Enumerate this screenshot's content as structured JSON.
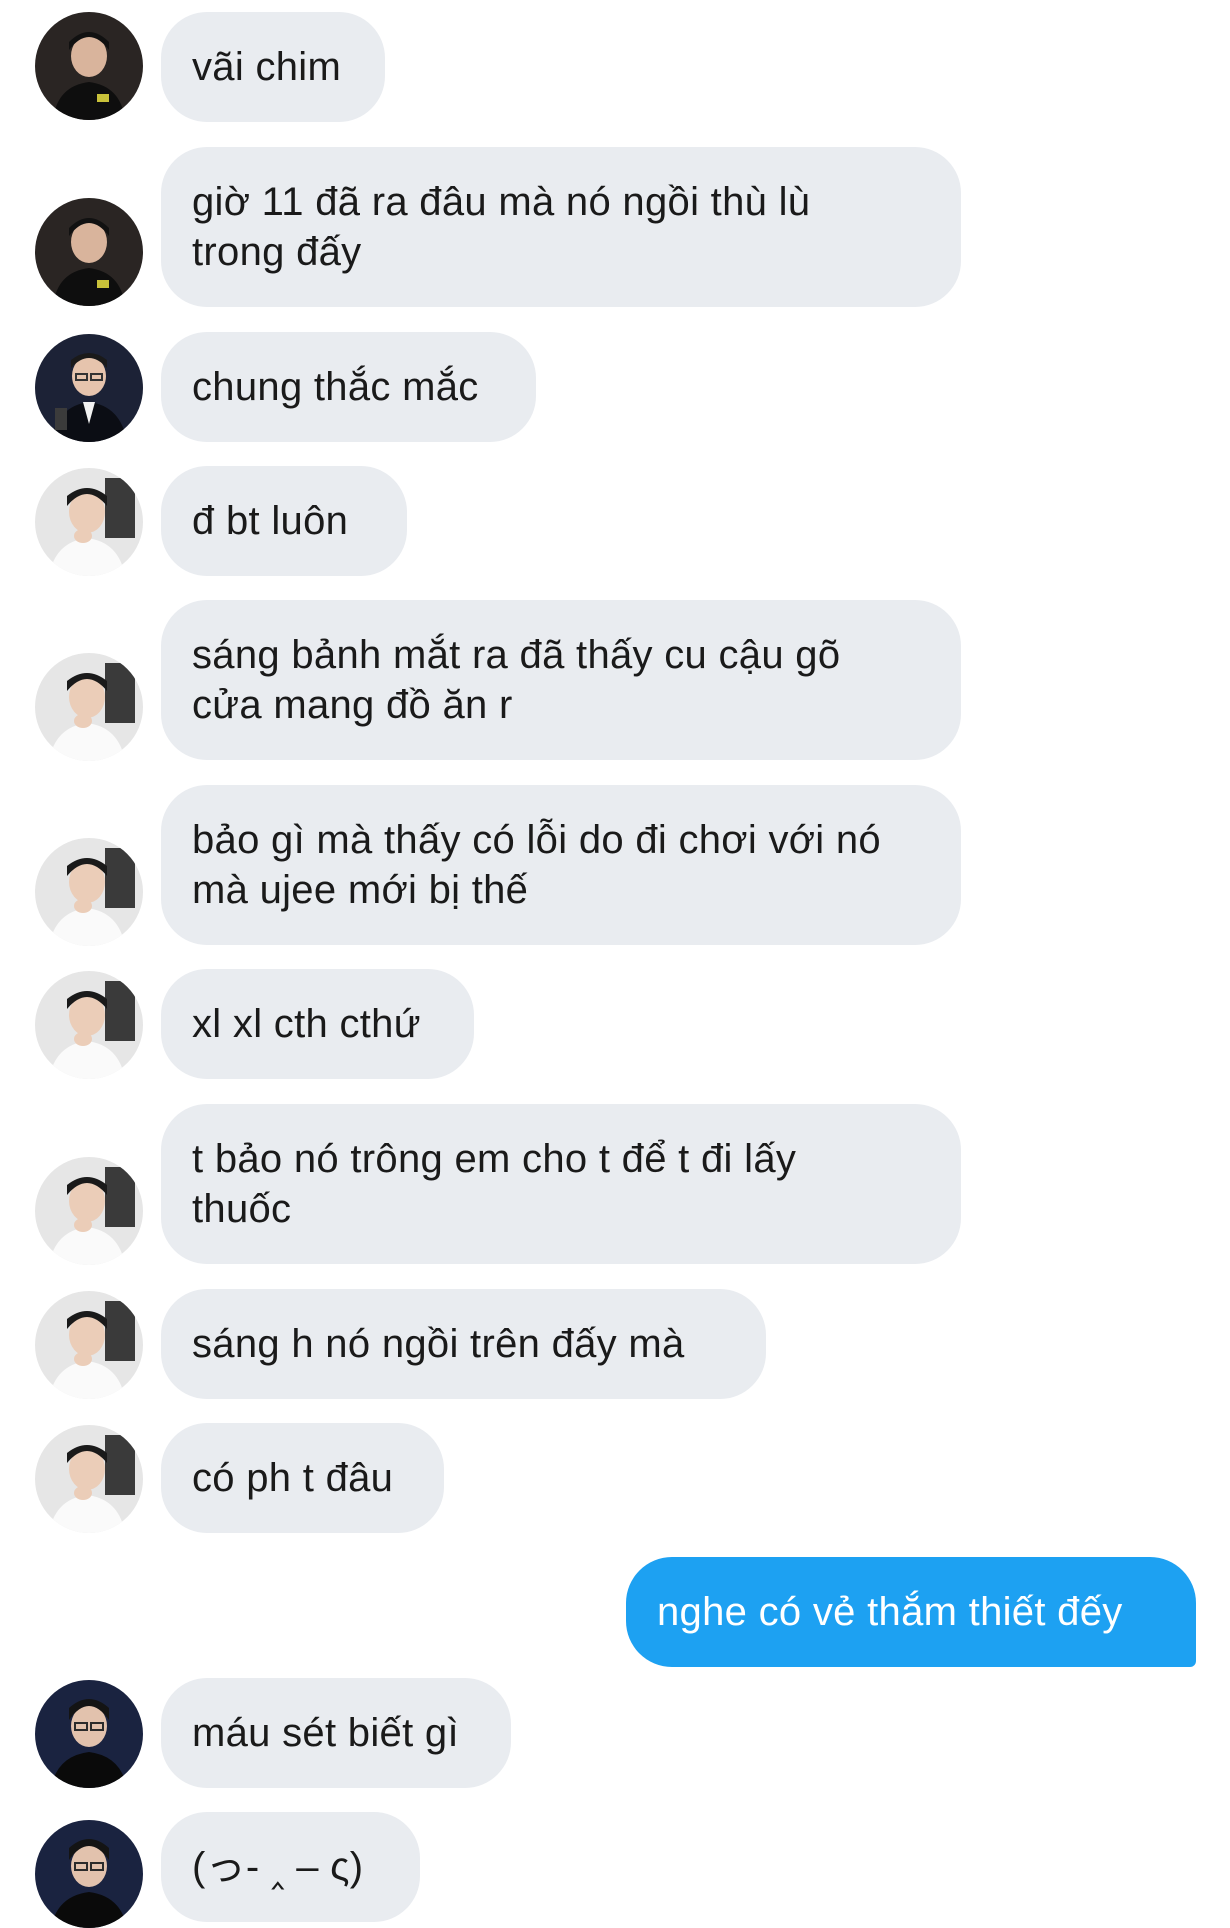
{
  "colors": {
    "incoming_bubble": "#e9ecf0",
    "outgoing_bubble": "#1da1f2",
    "text_dark": "#1a1a1a",
    "text_light": "#ffffff"
  },
  "messages": [
    {
      "direction": "incoming",
      "avatar": "avatar-dark-jacket",
      "text": "vãi chim"
    },
    {
      "direction": "incoming",
      "avatar": "avatar-dark-jacket",
      "text": "giờ 11 đã ra đâu mà nó ngồi thù lù trong đấy"
    },
    {
      "direction": "incoming",
      "avatar": "avatar-suit-glasses",
      "text": "chung thắc mắc"
    },
    {
      "direction": "incoming",
      "avatar": "avatar-white-shirt",
      "text": "đ bt luôn"
    },
    {
      "direction": "incoming",
      "avatar": "avatar-white-shirt",
      "text": "sáng bảnh mắt ra đã thấy cu cậu gõ cửa mang đồ ăn r"
    },
    {
      "direction": "incoming",
      "avatar": "avatar-white-shirt",
      "text": "bảo gì mà thấy có lỗi do đi chơi với nó mà ujee mới bị thế"
    },
    {
      "direction": "incoming",
      "avatar": "avatar-white-shirt",
      "text": "xl xl cth cthứ"
    },
    {
      "direction": "incoming",
      "avatar": "avatar-white-shirt",
      "text": "t bảo nó trông em cho t để t đi lấy thuốc"
    },
    {
      "direction": "incoming",
      "avatar": "avatar-white-shirt",
      "text": "sáng h nó ngồi trên đấy mà"
    },
    {
      "direction": "incoming",
      "avatar": "avatar-white-shirt",
      "text": "có ph t đâu"
    },
    {
      "direction": "outgoing",
      "text": "nghe có vẻ thắm thiết đếy"
    },
    {
      "direction": "incoming",
      "avatar": "avatar-navy-glasses",
      "text": "máu sét biết gì"
    },
    {
      "direction": "incoming",
      "avatar": "avatar-navy-glasses",
      "text": "(っ- ‸ – ς)"
    }
  ]
}
